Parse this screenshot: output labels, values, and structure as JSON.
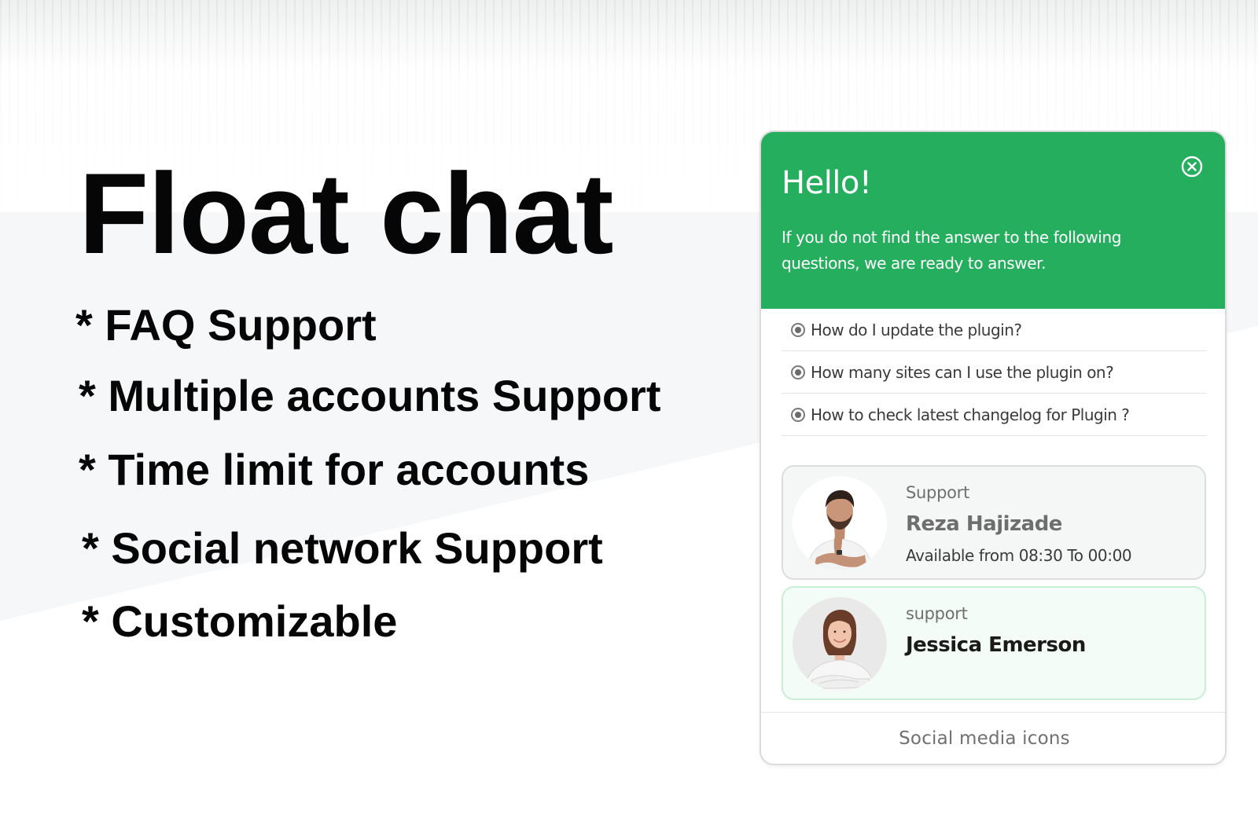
{
  "promo": {
    "headline": "Float chat",
    "features": [
      "* FAQ Support",
      "* Multiple accounts Support",
      "* Time limit for accounts",
      "* Social network Support",
      "* Customizable"
    ]
  },
  "widget": {
    "theme_color": "#26ae5f",
    "close_icon": "close-circle-icon",
    "greeting": "Hello!",
    "intro": "If you do not find the answer to the following questions, we are ready to answer.",
    "faq": [
      "How do I update the plugin?",
      "How many sites can I use the plugin on?",
      "How to check latest changelog for Plugin ?"
    ],
    "agents": [
      {
        "role": "Support",
        "name": "Reza Hajizade",
        "availability": "Available from 08:30 To 00:00"
      },
      {
        "role": "support",
        "name": "Jessica Emerson"
      }
    ],
    "footer_label": "Social media icons"
  }
}
